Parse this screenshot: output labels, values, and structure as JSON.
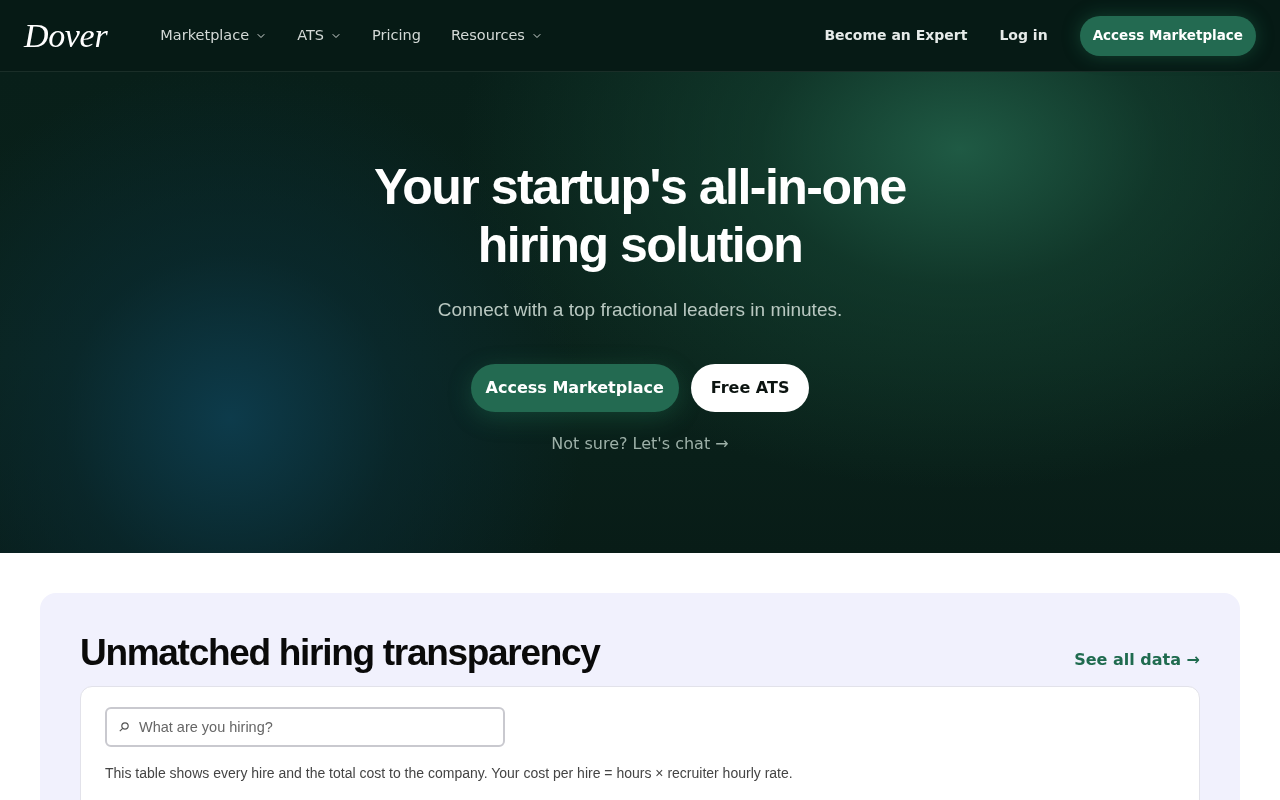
{
  "header": {
    "logo": "Dover",
    "nav": [
      {
        "label": "Marketplace",
        "kind": "dropdown"
      },
      {
        "label": "ATS",
        "kind": "dropdown"
      },
      {
        "label": "Pricing",
        "kind": "link"
      },
      {
        "label": "Resources",
        "kind": "dropdown"
      }
    ],
    "actions": [
      {
        "label": "Become an Expert",
        "kind": "link"
      },
      {
        "label": "Log in",
        "kind": "link"
      },
      {
        "label": "Access Marketplace",
        "kind": "button"
      }
    ]
  },
  "hero": {
    "title": "Your startup's all-in-one hiring solution",
    "subtitle": "Connect with a top fractional leaders in minutes.",
    "buttons": [
      {
        "label": "Access Marketplace",
        "kind": "primary"
      },
      {
        "label": "Free ATS",
        "kind": "secondary"
      }
    ],
    "chat_link": "Not sure? Let's chat →"
  },
  "transparency": {
    "title": "Unmatched hiring transparency",
    "see_all": "See all data →",
    "search": {
      "placeholder": "What are you hiring?"
    },
    "note": "This table shows every hire and the total cost to the company. Your cost per hire = hours × recruiter hourly rate."
  }
}
